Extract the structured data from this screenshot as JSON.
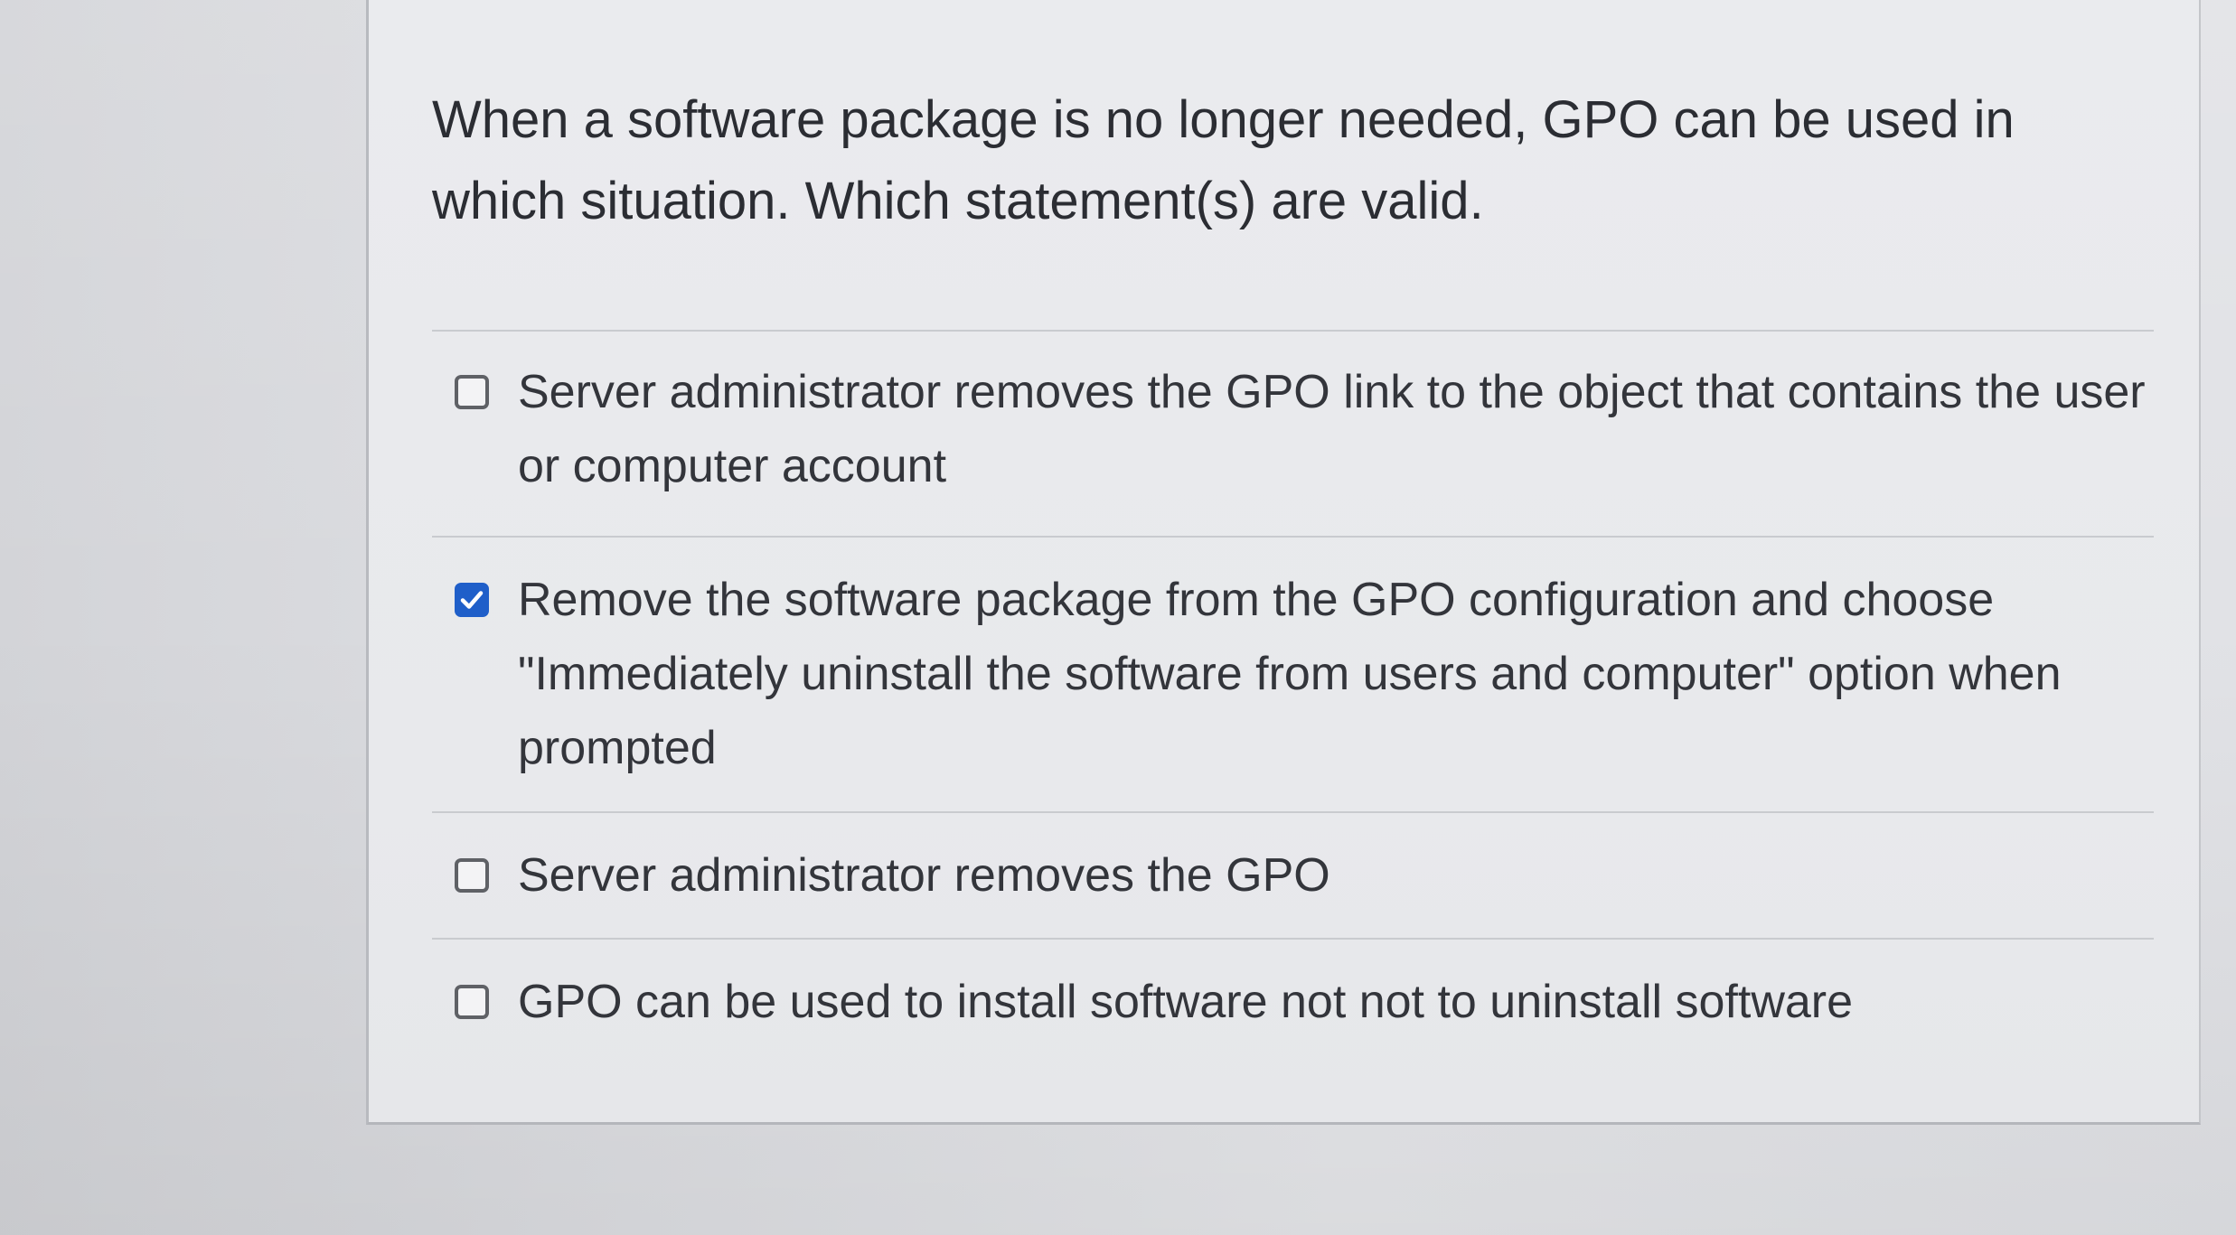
{
  "question": {
    "text": "When a software package is no longer needed, GPO can be used in which situation.  Which statement(s) are valid."
  },
  "answers": [
    {
      "label": "Server administrator removes the GPO link to the object that contains the user or computer account",
      "checked": false
    },
    {
      "label": "Remove the software package from the GPO configuration and choose \"Immediately uninstall the software from users and computer\" option when prompted",
      "checked": true
    },
    {
      "label": "Server administrator removes the GPO",
      "checked": false
    },
    {
      "label": "GPO can be used to install software not not to uninstall software",
      "checked": false
    }
  ],
  "colors": {
    "checkbox_checked": "#1f5fc9",
    "text": "#33353b"
  },
  "icons": {
    "checked_box": "checkmark-icon"
  }
}
